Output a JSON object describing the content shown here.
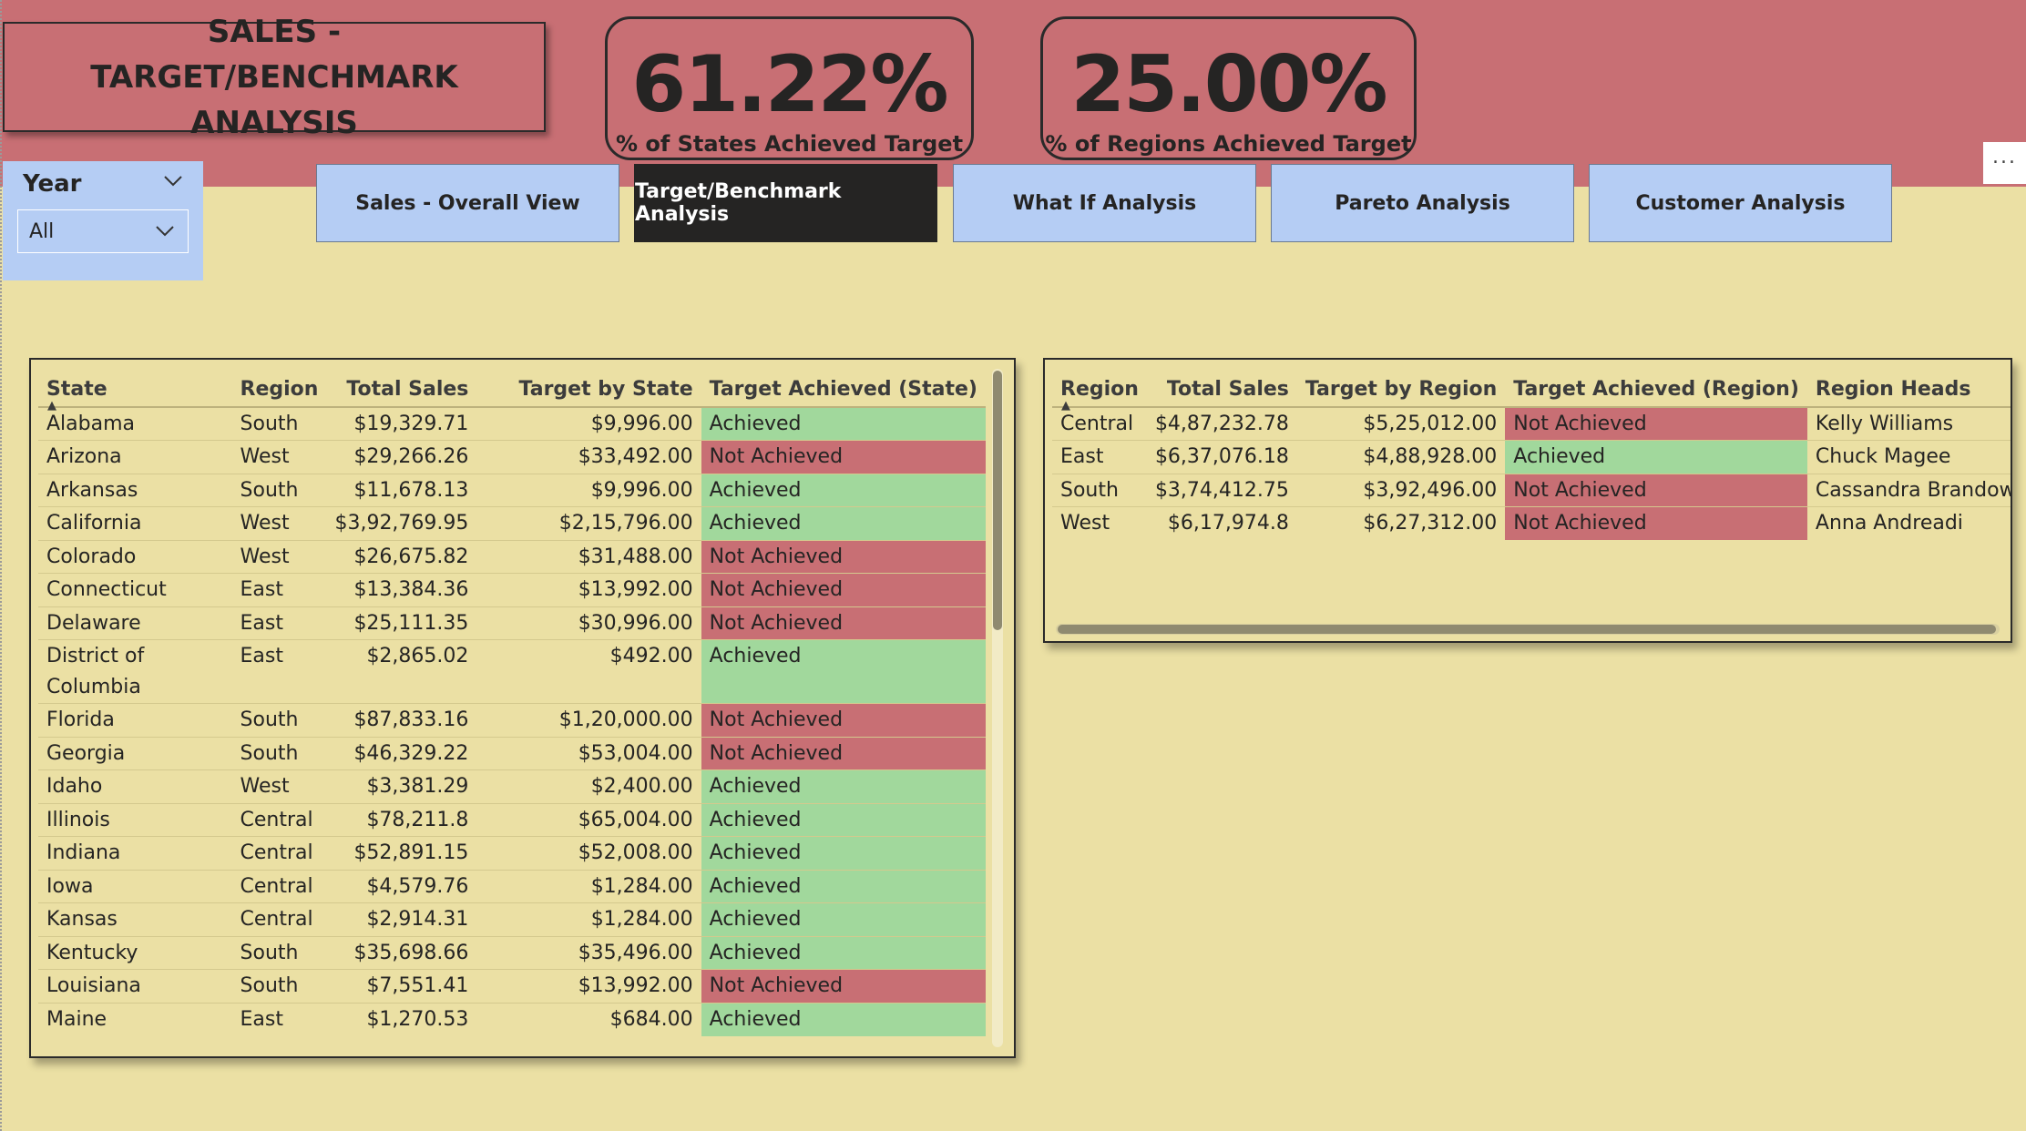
{
  "header": {
    "title": "SALES - TARGET/BENCHMARK ANALYSIS",
    "kpis": [
      {
        "value": "61.22%",
        "label": "% of States Achieved Target"
      },
      {
        "value": "25.00%",
        "label": "% of Regions Achieved Target"
      }
    ],
    "more_options": "..."
  },
  "slicer": {
    "title": "Year",
    "selected": "All"
  },
  "nav": {
    "buttons": [
      {
        "label": "Sales - Overall View"
      },
      {
        "label": "Target/Benchmark Analysis"
      },
      {
        "label": "What If Analysis"
      },
      {
        "label": "Pareto Analysis"
      },
      {
        "label": "Customer Analysis"
      }
    ],
    "active_index": 1
  },
  "state_table": {
    "columns": [
      "State",
      "Region",
      "Total Sales",
      "Target by State",
      "Target Achieved (State)"
    ],
    "rows": [
      [
        "Alabama",
        "South",
        "$19,329.71",
        "$9,996.00",
        "Achieved"
      ],
      [
        "Arizona",
        "West",
        "$29,266.26",
        "$33,492.00",
        "Not Achieved"
      ],
      [
        "Arkansas",
        "South",
        "$11,678.13",
        "$9,996.00",
        "Achieved"
      ],
      [
        "California",
        "West",
        "$3,92,769.95",
        "$2,15,796.00",
        "Achieved"
      ],
      [
        "Colorado",
        "West",
        "$26,675.82",
        "$31,488.00",
        "Not Achieved"
      ],
      [
        "Connecticut",
        "East",
        "$13,384.36",
        "$13,992.00",
        "Not Achieved"
      ],
      [
        "Delaware",
        "East",
        "$25,111.35",
        "$30,996.00",
        "Not Achieved"
      ],
      [
        "District of Columbia",
        "East",
        "$2,865.02",
        "$492.00",
        "Achieved"
      ],
      [
        "Florida",
        "South",
        "$87,833.16",
        "$1,20,000.00",
        "Not Achieved"
      ],
      [
        "Georgia",
        "South",
        "$46,329.22",
        "$53,004.00",
        "Not Achieved"
      ],
      [
        "Idaho",
        "West",
        "$3,381.29",
        "$2,400.00",
        "Achieved"
      ],
      [
        "Illinois",
        "Central",
        "$78,211.8",
        "$65,004.00",
        "Achieved"
      ],
      [
        "Indiana",
        "Central",
        "$52,891.15",
        "$52,008.00",
        "Achieved"
      ],
      [
        "Iowa",
        "Central",
        "$4,579.76",
        "$1,284.00",
        "Achieved"
      ],
      [
        "Kansas",
        "Central",
        "$2,914.31",
        "$1,284.00",
        "Achieved"
      ],
      [
        "Kentucky",
        "South",
        "$35,698.66",
        "$35,496.00",
        "Achieved"
      ],
      [
        "Louisiana",
        "South",
        "$7,551.41",
        "$13,992.00",
        "Not Achieved"
      ],
      [
        "Maine",
        "East",
        "$1,270.53",
        "$684.00",
        "Achieved"
      ]
    ]
  },
  "region_table": {
    "columns": [
      "Region",
      "Total Sales",
      "Target by Region",
      "Target Achieved (Region)",
      "Region Heads"
    ],
    "rows": [
      [
        "Central",
        "$4,87,232.78",
        "$5,25,012.00",
        "Not Achieved",
        "Kelly Williams"
      ],
      [
        "East",
        "$6,37,076.18",
        "$4,88,928.00",
        "Achieved",
        "Chuck Magee"
      ],
      [
        "South",
        "$3,74,412.75",
        "$3,92,496.00",
        "Not Achieved",
        "Cassandra Brandow"
      ],
      [
        "West",
        "$6,17,974.8",
        "$6,27,312.00",
        "Not Achieved",
        "Anna Andreadi"
      ]
    ]
  },
  "colors": {
    "achieved": "#a1d89c",
    "not_achieved": "#c86f74",
    "background": "#ebe0a4",
    "header_band": "#c86f74",
    "button": "#b5cdf4",
    "button_active": "#252423"
  }
}
